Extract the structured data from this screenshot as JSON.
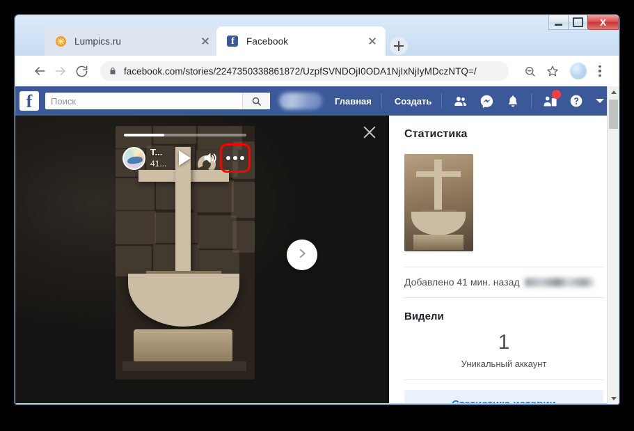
{
  "window": {
    "controls": {
      "minimize_label": "—",
      "maximize_label": "□",
      "close_label": "X"
    }
  },
  "tabs": [
    {
      "title": "Lumpics.ru",
      "favicon": "orange-slice-icon",
      "active": false
    },
    {
      "title": "Facebook",
      "favicon": "facebook-f-icon",
      "active": true
    }
  ],
  "new_tab_label": "+",
  "toolbar": {
    "back_icon": "back-arrow-icon",
    "forward_icon": "forward-arrow-icon",
    "reload_icon": "reload-icon",
    "lock_icon": "lock-icon",
    "url": "facebook.com/stories/2247350338861872/UzpfSVNDOjI0ODA1NjIxNjIyMDczNTQ=/",
    "zoom_icon": "zoom-out-icon",
    "bookmark_icon": "star-icon",
    "profile_icon": "avatar-icon",
    "menu_icon": "three-dots-vertical-icon"
  },
  "fb_header": {
    "logo_letter": "f",
    "search_placeholder": "Поиск",
    "search_icon": "search-icon",
    "nav_links": [
      {
        "label": "Главная"
      },
      {
        "label": "Создать"
      }
    ],
    "icons": [
      {
        "name": "friend-requests-icon"
      },
      {
        "name": "messenger-icon"
      },
      {
        "name": "notifications-bell-icon"
      },
      {
        "name": "friend-request-badge-icon",
        "badge": true
      },
      {
        "name": "help-icon"
      }
    ],
    "caret_icon": "chevron-down-icon",
    "accent_color": "#3b5998",
    "badge_color": "#fa3e3e"
  },
  "story": {
    "close_icon": "close-icon",
    "progress_percent": 33,
    "avatar_icon": "story-author-avatar",
    "author": "T...",
    "time": "41...",
    "play_icon": "play-icon",
    "volume_icon": "volume-on-icon",
    "more_icon": "more-options-icon",
    "next_icon": "next-chevron-icon",
    "highlight_color": "#ff0000"
  },
  "stats": {
    "title": "Статистика",
    "thumbnail_name": "story-thumbnail",
    "added_text": "Добавлено 41 мин. назад",
    "seen_title": "Видели",
    "count": "1",
    "count_label": "Уникальный аккаунт",
    "button_label": "Статистика истории",
    "button_text_color": "#1877f2"
  },
  "scrollbar": {
    "up_icon": "scroll-up-arrow-icon",
    "down_icon": "scroll-down-arrow-icon"
  }
}
